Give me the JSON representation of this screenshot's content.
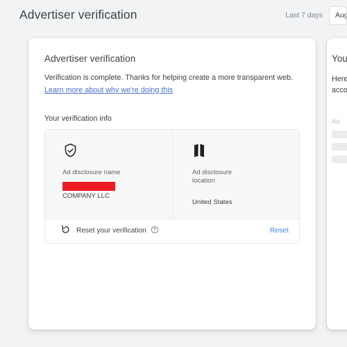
{
  "header": {
    "title": "Advertiser verification",
    "daterange_label": "Last 7 days",
    "daterange_button": "Aug"
  },
  "card": {
    "title": "Advertiser verification",
    "description": "Verification is complete. Thanks for helping create a more transparent web.",
    "link": "Learn more about why we're doing this",
    "section_title": "Your verification info",
    "info": [
      {
        "icon": "shield-check-icon",
        "label": "Ad disclosure name",
        "redacted": true,
        "value": "COMPANY LLC"
      },
      {
        "icon": "map-icon",
        "label": "Ad disclosure location",
        "redacted": false,
        "value": "United States"
      }
    ],
    "reset": {
      "icon": "restore-icon",
      "text": "Reset your verification",
      "help_icon": "help-circle-icon",
      "action": "Reset"
    }
  },
  "side_panel": {
    "title": "You",
    "desc_line1": "Here",
    "desc_line2": "acco",
    "sub_label": "Ad",
    "skeleton_count": 3
  },
  "colors": {
    "page_bg": "#f1f3f4",
    "card_bg": "#ffffff",
    "link": "#4a6fd4",
    "action_link": "#4285f4",
    "redaction": "#ee1b24",
    "text": "#3c4043",
    "muted": "#5f6368"
  }
}
